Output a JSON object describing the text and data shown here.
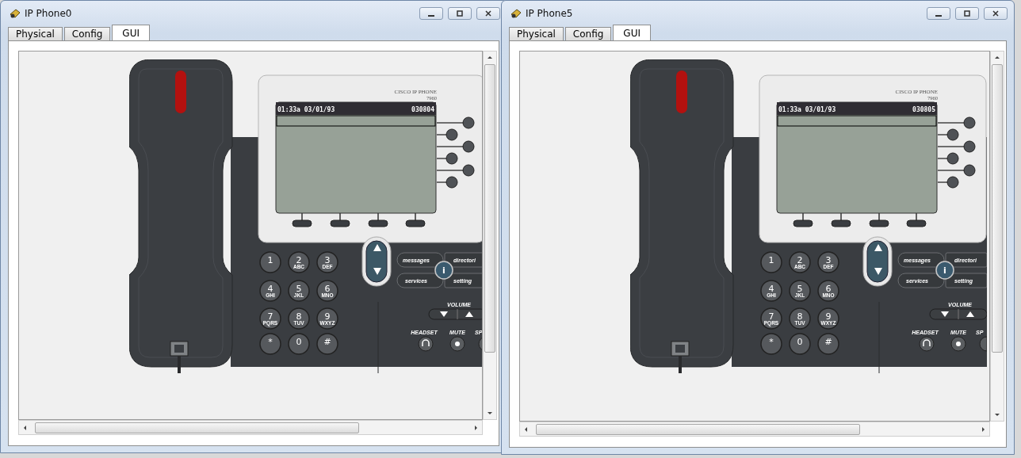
{
  "windows": [
    {
      "title": "IP Phone0",
      "tabs": [
        {
          "label": "Physical",
          "selected": false
        },
        {
          "label": "Config",
          "selected": false
        },
        {
          "label": "GUI",
          "selected": true
        }
      ],
      "phone": {
        "brand": "CISCO IP PHONE",
        "model": "7960",
        "status_time": "01:33a 03/01/93",
        "extension": "030804",
        "keypad": [
          {
            "digit": "1"
          },
          {
            "digit": "2",
            "letters": "ABC"
          },
          {
            "digit": "3",
            "letters": "DEF"
          },
          {
            "digit": "4",
            "letters": "GHI"
          },
          {
            "digit": "5",
            "letters": "JKL"
          },
          {
            "digit": "6",
            "letters": "MNO"
          },
          {
            "digit": "7",
            "letters": "PQRS"
          },
          {
            "digit": "8",
            "letters": "TUV"
          },
          {
            "digit": "9",
            "letters": "WXYZ"
          },
          {
            "digit": "*"
          },
          {
            "digit": "0"
          },
          {
            "digit": "#"
          }
        ],
        "feature_buttons": [
          "messages",
          "directori",
          "services",
          "setting"
        ],
        "info_label": "i",
        "volume_label": "VOLUME",
        "headset_label": "HEADSET",
        "mute_label": "MUTE",
        "speaker_label": "SP"
      }
    },
    {
      "title": "IP Phone5",
      "tabs": [
        {
          "label": "Physical",
          "selected": false
        },
        {
          "label": "Config",
          "selected": false
        },
        {
          "label": "GUI",
          "selected": true
        }
      ],
      "phone": {
        "brand": "CISCO IP PHONE",
        "model": "7960",
        "status_time": "01:33a 03/01/93",
        "extension": "030805",
        "keypad": [
          {
            "digit": "1"
          },
          {
            "digit": "2",
            "letters": "ABC"
          },
          {
            "digit": "3",
            "letters": "DEF"
          },
          {
            "digit": "4",
            "letters": "GHI"
          },
          {
            "digit": "5",
            "letters": "JKL"
          },
          {
            "digit": "6",
            "letters": "MNO"
          },
          {
            "digit": "7",
            "letters": "PQRS"
          },
          {
            "digit": "8",
            "letters": "TUV"
          },
          {
            "digit": "9",
            "letters": "WXYZ"
          },
          {
            "digit": "*"
          },
          {
            "digit": "0"
          },
          {
            "digit": "#"
          }
        ],
        "feature_buttons": [
          "messages",
          "directori",
          "services",
          "setting"
        ],
        "info_label": "i",
        "volume_label": "VOLUME",
        "headset_label": "HEADSET",
        "mute_label": "MUTE",
        "speaker_label": "SP"
      }
    }
  ]
}
